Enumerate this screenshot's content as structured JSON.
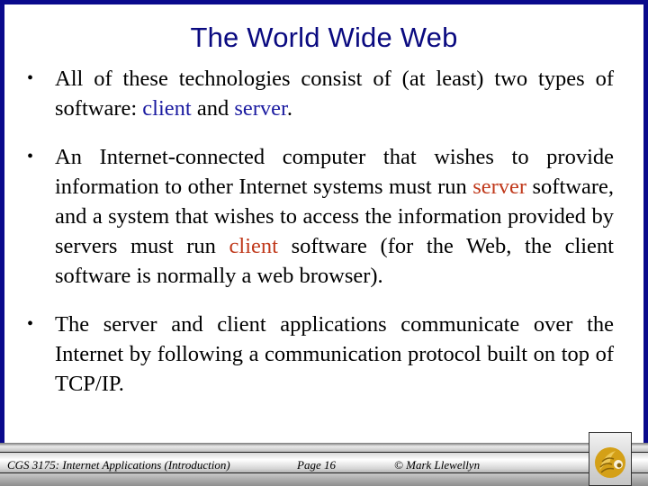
{
  "slide": {
    "title": "The World Wide Web",
    "bullets": [
      {
        "parts": [
          {
            "text": "All of these technologies consist of (at least) two types of software: "
          },
          {
            "text": "client",
            "color": "blue"
          },
          {
            "text": " and "
          },
          {
            "text": "server",
            "color": "blue"
          },
          {
            "text": "."
          }
        ]
      },
      {
        "parts": [
          {
            "text": "An Internet-connected computer that wishes to provide information to other Internet systems must run "
          },
          {
            "text": "server",
            "color": "red"
          },
          {
            "text": " software, and a system that wishes to access the information provided by servers must run "
          },
          {
            "text": "client",
            "color": "red"
          },
          {
            "text": " software (for the Web, the client software is normally a web browser)."
          }
        ]
      },
      {
        "parts": [
          {
            "text": "The server and client applications communicate over the Internet by following a communication protocol built on top of TCP/IP."
          }
        ]
      }
    ],
    "bullet_glyph": "•"
  },
  "footer": {
    "course": "CGS 3175: Internet Applications (Introduction)",
    "page": "Page 16",
    "author": "© Mark Llewellyn",
    "logo_icon": "ucf-pegasus-logo-icon"
  },
  "colors": {
    "frame": "#0a0a8c",
    "title": "#0a0a80",
    "highlight_blue": "#1a1aa0",
    "highlight_red": "#c0391b",
    "logo_gold": "#d4a017"
  }
}
